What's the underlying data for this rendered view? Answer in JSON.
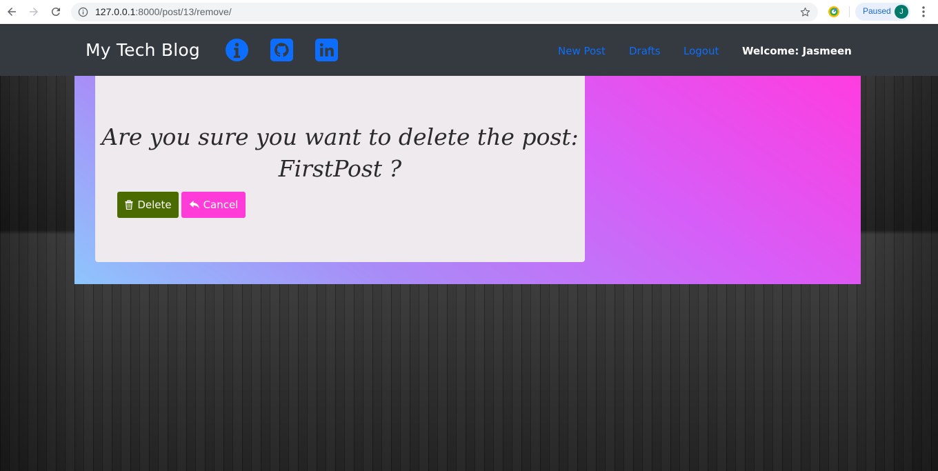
{
  "browser": {
    "url_host": "127.0.0.1",
    "url_path": ":8000/post/13/remove/",
    "profile_status": "Paused",
    "profile_initial": "J",
    "icons": [
      "back-arrow-icon",
      "forward-arrow-icon",
      "reload-icon",
      "info-icon",
      "star-icon",
      "extension-icon",
      "menu-dots-icon"
    ]
  },
  "navbar": {
    "brand": "My Tech Blog",
    "social_icons": [
      "info-circle-icon",
      "github-icon",
      "linkedin-icon"
    ],
    "links": {
      "new_post": "New Post",
      "drafts": "Drafts",
      "logout": "Logout"
    },
    "welcome": "Welcome: Jasmeen",
    "link_color": "#0d6efd"
  },
  "confirm": {
    "question_line1": "Are you sure you want to delete the post:",
    "question_line2": "FirstPost ?",
    "delete_label": "Delete",
    "cancel_label": "Cancel",
    "delete_color": "#4a6b00",
    "cancel_color": "#ff3cd8"
  }
}
